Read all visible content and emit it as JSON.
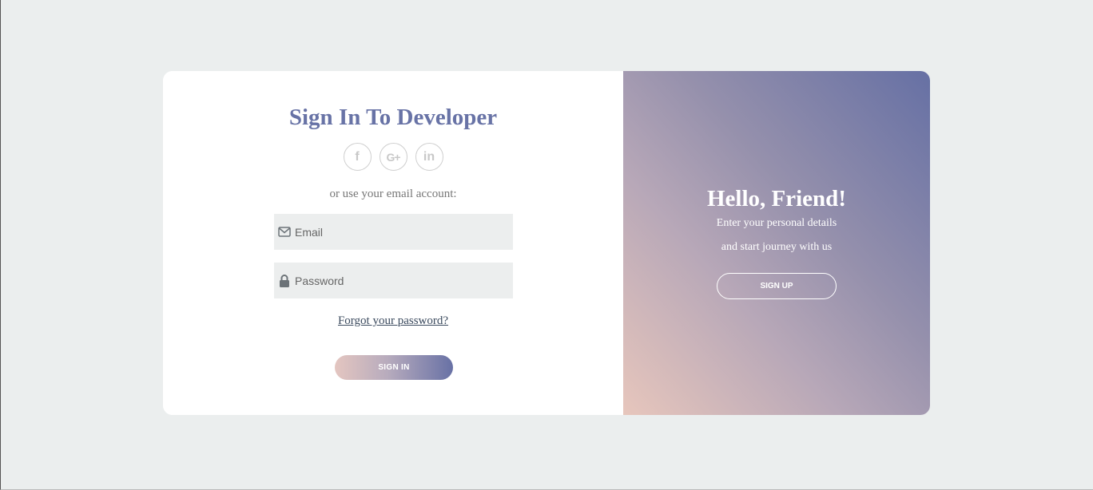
{
  "signin": {
    "title": "Sign In To Developer",
    "socials": [
      {
        "name": "facebook-icon",
        "glyph": "f"
      },
      {
        "name": "google-plus-icon",
        "glyph": "G+"
      },
      {
        "name": "linkedin-icon",
        "glyph": "in"
      }
    ],
    "subtext": "or use your email account:",
    "email_placeholder": "Email",
    "password_placeholder": "Password",
    "forgot_link": "Forgot your password?",
    "button_label": "SIGN IN"
  },
  "signup_panel": {
    "title": "Hello, Friend!",
    "line1": "Enter your personal details",
    "line2": "and start journey with us",
    "button_label": "SIGN UP"
  },
  "colors": {
    "accent": "#6873a6",
    "gradient_light": "#e7c6bc",
    "gradient_dark": "#6670a4",
    "background": "#ebeeee",
    "field_bg": "#eceeee"
  }
}
